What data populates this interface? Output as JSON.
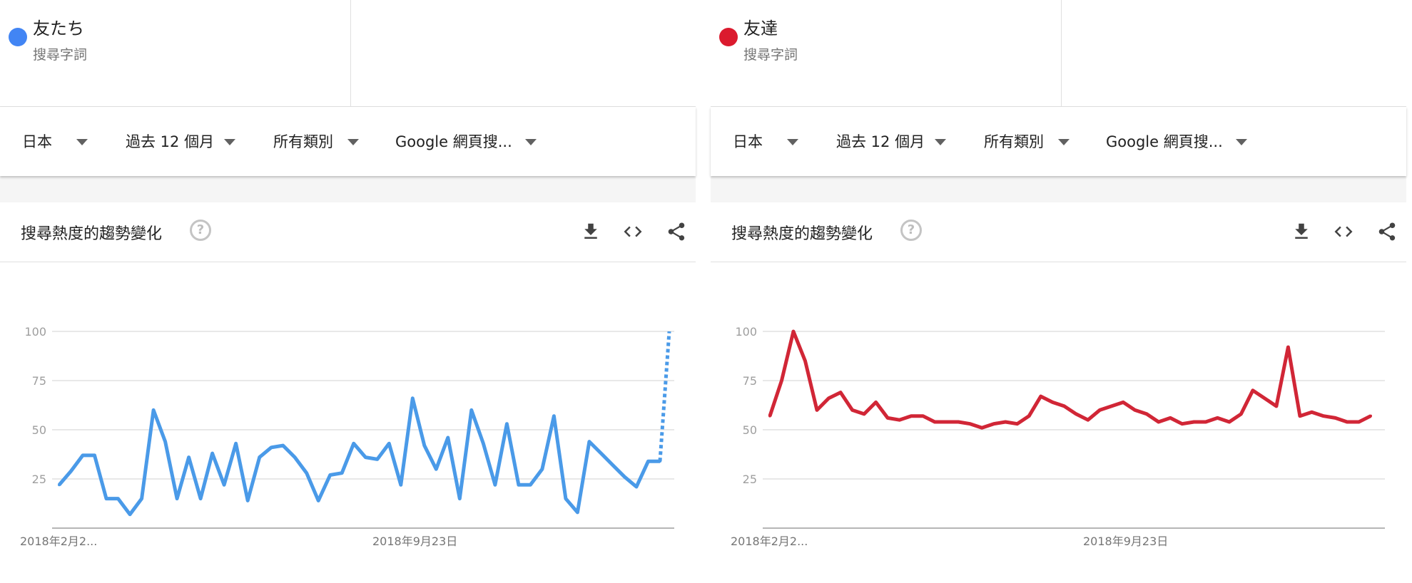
{
  "panels": [
    {
      "term": {
        "name": "友たち",
        "subtitle": "搜尋字詞",
        "color": "#4285f4"
      },
      "filters": [
        {
          "label": "日本"
        },
        {
          "label": "過去 12 個月"
        },
        {
          "label": "所有類別"
        },
        {
          "label": "Google 網頁搜..."
        }
      ],
      "widget": {
        "title": "搜尋熱度的趨勢變化",
        "help": "?"
      }
    },
    {
      "term": {
        "name": "友達",
        "subtitle": "搜尋字詞",
        "color": "#db1a2e"
      },
      "filters": [
        {
          "label": "日本"
        },
        {
          "label": "過去 12 個月"
        },
        {
          "label": "所有類別"
        },
        {
          "label": "Google 網頁搜..."
        }
      ],
      "widget": {
        "title": "搜尋熱度的趨勢變化",
        "help": "?"
      }
    }
  ],
  "chart_data": [
    {
      "type": "line",
      "y_ticks": [
        100,
        75,
        50,
        25
      ],
      "x_tick_labels": [
        "2018年2月2...",
        "2018年9月23日"
      ],
      "ylim": [
        0,
        100
      ],
      "grid": true,
      "line_color": "#4a9ae8",
      "series": [
        {
          "values": [
            22,
            29,
            37,
            37,
            15,
            15,
            7,
            15,
            60,
            44,
            15,
            36,
            15,
            38,
            22,
            43,
            14,
            36,
            41,
            42,
            36,
            28,
            14,
            27,
            28,
            43,
            36,
            35,
            43,
            22,
            66,
            42,
            30,
            46,
            15,
            60,
            43,
            22,
            53,
            22,
            22,
            30,
            57,
            15,
            8,
            44,
            38,
            32,
            26,
            21,
            34,
            34
          ],
          "partial": [
            34,
            100
          ]
        }
      ]
    },
    {
      "type": "line",
      "y_ticks": [
        100,
        75,
        50,
        25
      ],
      "x_tick_labels": [
        "2018年2月2...",
        "2018年9月23日"
      ],
      "ylim": [
        0,
        100
      ],
      "grid": true,
      "line_color": "#d12636",
      "series": [
        {
          "values": [
            57,
            75,
            100,
            85,
            60,
            66,
            69,
            60,
            58,
            64,
            56,
            55,
            57,
            57,
            54,
            54,
            54,
            53,
            51,
            53,
            54,
            53,
            57,
            67,
            64,
            62,
            58,
            55,
            60,
            62,
            64,
            60,
            58,
            54,
            56,
            53,
            54,
            54,
            56,
            54,
            58,
            70,
            66,
            62,
            92,
            57,
            59,
            57,
            56,
            54,
            54,
            57
          ]
        }
      ]
    }
  ]
}
